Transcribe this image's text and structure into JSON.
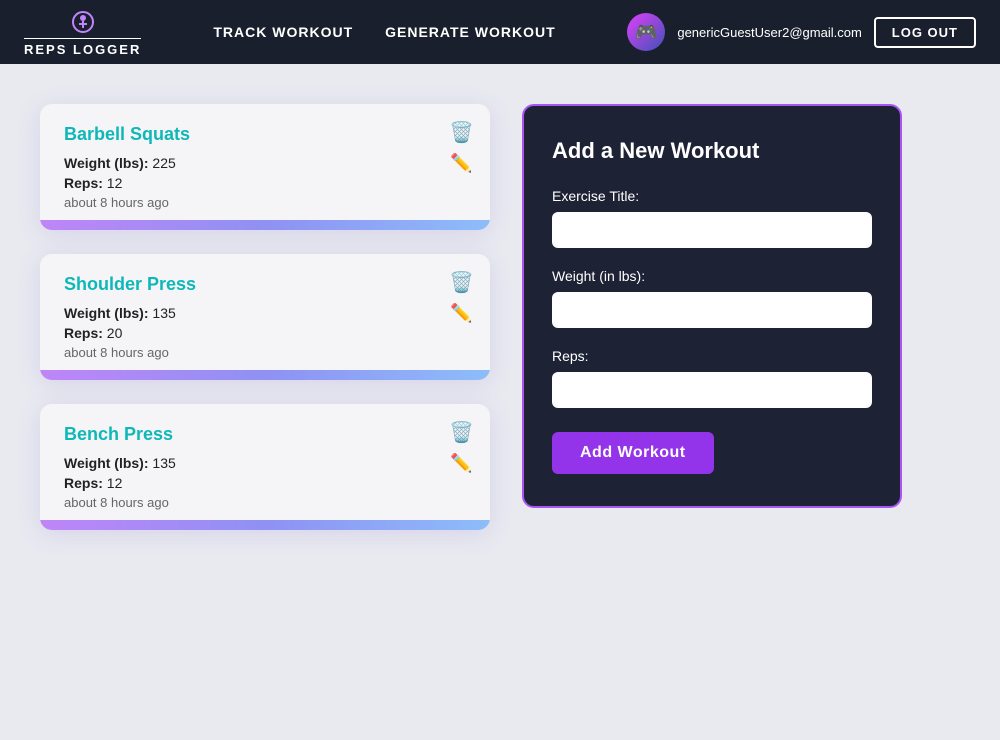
{
  "navbar": {
    "logo_text": "REPS LOGGER",
    "nav_links": [
      {
        "label": "TRACK WORKOUT",
        "id": "track-workout"
      },
      {
        "label": "GENERATE WORKOUT",
        "id": "generate-workout"
      }
    ],
    "user_email": "genericGuestUser2@gmail.com",
    "logout_label": "LOG OUT",
    "avatar_emoji": "🎮"
  },
  "workouts": [
    {
      "title": "Barbell Squats",
      "weight_label": "Weight (lbs):",
      "weight_value": "225",
      "reps_label": "Reps:",
      "reps_value": "12",
      "time": "about 8 hours ago"
    },
    {
      "title": "Shoulder Press",
      "weight_label": "Weight (lbs):",
      "weight_value": "135",
      "reps_label": "Reps:",
      "reps_value": "20",
      "time": "about 8 hours ago"
    },
    {
      "title": "Bench Press",
      "weight_label": "Weight (lbs):",
      "weight_value": "135",
      "reps_label": "Reps:",
      "reps_value": "12",
      "time": "about 8 hours ago"
    }
  ],
  "form": {
    "title": "Add a New Workout",
    "exercise_title_label": "Exercise Title:",
    "exercise_title_placeholder": "",
    "weight_label": "Weight (in lbs):",
    "weight_placeholder": "",
    "reps_label": "Reps:",
    "reps_placeholder": "",
    "submit_label": "Add Workout"
  }
}
